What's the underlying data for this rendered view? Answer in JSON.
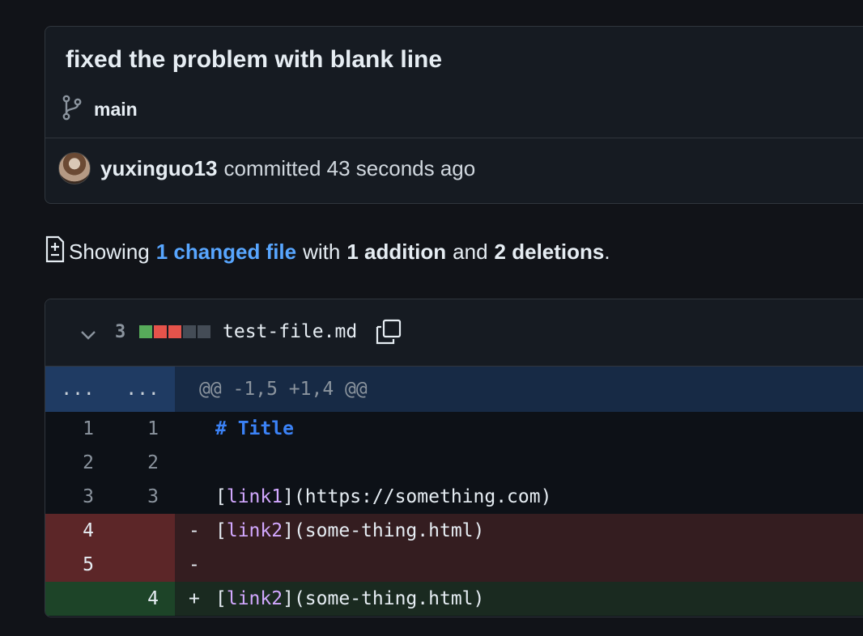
{
  "commit": {
    "title": "fixed the problem with blank line",
    "branch": "main",
    "author": "yuxinguo13",
    "action": "committed 43 seconds ago"
  },
  "summary": {
    "prefix": "Showing",
    "changed_files": "1 changed file",
    "with": "with",
    "additions": "1 addition",
    "and": "and",
    "deletions": "2 deletions",
    "period": "."
  },
  "file": {
    "changes": "3",
    "name": "test-file.md",
    "stat_blocks": [
      "added",
      "deleted",
      "deleted",
      "neutral",
      "neutral"
    ]
  },
  "colors": {
    "added": "#57ab5a",
    "deleted": "#e5534b",
    "neutral": "#444c56",
    "link": "#58a6ff"
  },
  "hunk": {
    "left": "...",
    "right": "...",
    "header": "@@ -1,5 +1,4 @@"
  },
  "lines": [
    {
      "type": "context",
      "old": "1",
      "new": "1",
      "sign": "",
      "prefix": "",
      "link": "",
      "rest": "",
      "title": "# Title"
    },
    {
      "type": "context",
      "old": "2",
      "new": "2",
      "sign": "",
      "prefix": "",
      "link": "",
      "rest": "",
      "title": ""
    },
    {
      "type": "context",
      "old": "3",
      "new": "3",
      "sign": "",
      "prefix": "[",
      "link": "link1",
      "rest": "](https://something.com)",
      "title": ""
    },
    {
      "type": "deletion",
      "old": "4",
      "new": "",
      "sign": "-",
      "prefix": "[",
      "link": "link2",
      "rest": "](some-thing.html)",
      "title": ""
    },
    {
      "type": "deletion",
      "old": "5",
      "new": "",
      "sign": "-",
      "prefix": "",
      "link": "",
      "rest": "",
      "title": ""
    },
    {
      "type": "addition",
      "old": "",
      "new": "4",
      "sign": "+",
      "prefix": "[",
      "link": "link2",
      "rest": "](some-thing.html)",
      "title": ""
    }
  ]
}
